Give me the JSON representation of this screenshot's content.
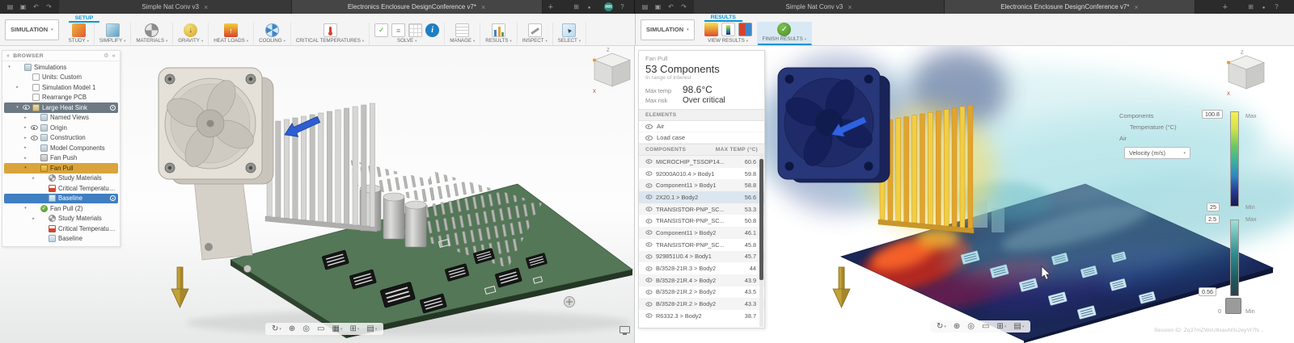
{
  "viewcube": {
    "z": "Z",
    "x": "X"
  },
  "setup_window": {
    "tb_icons_left": [
      "tbi-menu",
      "tbi-save",
      "tbi-undo",
      "tbi-redo"
    ],
    "tb_icons_right": [
      "tbi-ext",
      "tbi-bell"
    ],
    "avatar": "HH",
    "help_icon": "tbi-help",
    "tabs": [
      {
        "label": "Simple Nat Conv v3",
        "cls": ""
      },
      {
        "label": "Electronics Enclosure DesignConference v7*",
        "cls": "active"
      }
    ],
    "workspace": "SIMULATION",
    "ribbon_tab": "SETUP",
    "groups": [
      {
        "label": "STUDY",
        "icons": [
          "ic-study"
        ],
        "cls": ""
      },
      {
        "label": "SIMPLIFY",
        "icons": [
          "ic-simplify"
        ],
        "cls": ""
      },
      {
        "label": "MATERIALS",
        "icons": [
          "ic-materials"
        ],
        "cls": ""
      },
      {
        "label": "GRAVITY",
        "icons": [
          "ic-gravity"
        ],
        "cls": ""
      },
      {
        "label": "HEAT LOADS",
        "icons": [
          "ic-heat"
        ],
        "cls": ""
      },
      {
        "label": "COOLING",
        "icons": [
          "ic-cooling"
        ],
        "cls": ""
      },
      {
        "label": "CRITICAL TEMPERATURES",
        "icons": [
          "ic-critical"
        ],
        "cls": ""
      },
      {
        "label": "SOLVE",
        "icons": [
          "ic-precheck",
          "ic-compare",
          "ic-table",
          "ic-info"
        ],
        "cls": ""
      },
      {
        "label": "MANAGE",
        "icons": [
          "ic-manage"
        ],
        "cls": ""
      },
      {
        "label": "RESULTS",
        "icons": [
          "ic-results"
        ],
        "cls": ""
      },
      {
        "label": "INSPECT",
        "icons": [
          "ic-inspect"
        ],
        "cls": ""
      },
      {
        "label": "SELECT",
        "icons": [
          "ic-select"
        ],
        "cls": ""
      }
    ],
    "browser": {
      "title": "BROWSER",
      "tree": [
        {
          "arrow": "▾",
          "eye": "none",
          "icon": "tic-folder",
          "label": "Simulations",
          "cls": "ind0",
          "trail": ""
        },
        {
          "arrow": "",
          "eye": "none",
          "icon": "tic-doc",
          "label": "Units: Custom",
          "cls": "ind1",
          "trail": ""
        },
        {
          "arrow": "▸",
          "eye": "none",
          "icon": "tic-doc",
          "label": "Simulation Model 1",
          "cls": "ind1",
          "trail": ""
        },
        {
          "arrow": "",
          "eye": "none",
          "icon": "tic-doc",
          "label": "Rearrange PCB",
          "cls": "ind1",
          "trail": ""
        },
        {
          "arrow": "▾",
          "eye": "show",
          "icon": "tic-model",
          "label": "Large Heat Sink",
          "cls": "ind1 sel-dark",
          "trail": "t-radio"
        },
        {
          "arrow": "▸",
          "eye": "none",
          "icon": "tic-folder",
          "label": "Named Views",
          "cls": "ind2",
          "trail": ""
        },
        {
          "arrow": "▸",
          "eye": "show",
          "icon": "tic-folder",
          "label": "Origin",
          "cls": "ind2",
          "trail": ""
        },
        {
          "arrow": "▸",
          "eye": "show",
          "icon": "tic-folder",
          "label": "Construction",
          "cls": "ind2",
          "trail": ""
        },
        {
          "arrow": "▸",
          "eye": "none",
          "icon": "tic-folder",
          "label": "Model Components",
          "cls": "ind2",
          "trail": ""
        },
        {
          "arrow": "▸",
          "eye": "none",
          "icon": "tic-study",
          "label": "Fan Push",
          "cls": "ind2",
          "trail": ""
        },
        {
          "arrow": "▾",
          "eye": "none",
          "icon": "tic-study-a",
          "label": "Fan Pull",
          "cls": "ind2 sel-orange",
          "trail": ""
        },
        {
          "arrow": "▸",
          "eye": "none",
          "icon": "tic-mat",
          "label": "Study Materials",
          "cls": "ind3",
          "trail": ""
        },
        {
          "arrow": "",
          "eye": "none",
          "icon": "tic-crit",
          "label": "Critical Temperatures",
          "cls": "ind3",
          "trail": ""
        },
        {
          "arrow": "",
          "eye": "none",
          "icon": "tic-base",
          "label": "Baseline",
          "cls": "ind3 sel-blue",
          "trail": "t-radio"
        },
        {
          "arrow": "▾",
          "eye": "none",
          "icon": "tic-check",
          "label": "Fan Pull (2)",
          "cls": "ind2",
          "trail": ""
        },
        {
          "arrow": "▸",
          "eye": "none",
          "icon": "tic-mat",
          "label": "Study Materials",
          "cls": "ind3",
          "trail": ""
        },
        {
          "arrow": "",
          "eye": "none",
          "icon": "tic-crit",
          "label": "Critical Temperatures",
          "cls": "ind3",
          "trail": ""
        },
        {
          "arrow": "",
          "eye": "none",
          "icon": "tic-base",
          "label": "Baseline",
          "cls": "ind3",
          "trail": ""
        }
      ]
    },
    "navbar": [
      "nv-orbit c",
      "nv-pan",
      "nv-zoom",
      "nv-fit",
      "nv-display c",
      "nv-grid c",
      "nv-set c"
    ]
  },
  "results_window": {
    "tb_icons_left": [
      "tbi-menu",
      "tbi-save",
      "tbi-undo",
      "tbi-redo"
    ],
    "tb_icons_right": [
      "tbi-ext",
      "tbi-bell",
      "tbi-help"
    ],
    "tabs": [
      {
        "label": "Simple Nat Conv v3",
        "cls": ""
      },
      {
        "label": "Electronics Enclosure DesignConference v7*",
        "cls": "active"
      }
    ],
    "workspace": "SIMULATION",
    "ribbon_tab": "RESULTS",
    "groups": [
      {
        "label": "VIEW RESULTS",
        "icons": [
          "ic-vr1",
          "ic-vr2",
          "ic-vr3"
        ],
        "cls": ""
      },
      {
        "label": "FINISH RESULTS",
        "icons": [
          "ic-finish"
        ],
        "cls": "hl"
      }
    ],
    "panel": {
      "study": "Fan Pull",
      "count": "53 Components",
      "range": "In range of interest",
      "max_temp_label": "Max temp",
      "max_temp": "98.6°C",
      "max_risk_label": "Max risk",
      "max_risk": "Over critical",
      "elements_header": "ELEMENTS",
      "elements": [
        {
          "label": "Air"
        },
        {
          "label": "Load case"
        }
      ],
      "components_header": "COMPONENTS",
      "temp_col": "MAX TEMP (°C)",
      "components": [
        {
          "name": "MICROCHIP_TSSOP14...",
          "temp": "60.6",
          "cls": ""
        },
        {
          "name": "92000A010.4 > Body1",
          "temp": "59.8",
          "cls": ""
        },
        {
          "name": "Component11 > Body1",
          "temp": "58.8",
          "cls": ""
        },
        {
          "name": "2X20.1 > Body2",
          "temp": "56.6",
          "cls": "selrow"
        },
        {
          "name": "TRANSISTOR-PNP_SC...",
          "temp": "53.3",
          "cls": ""
        },
        {
          "name": "TRANSISTOR-PNP_SC...",
          "temp": "50.8",
          "cls": ""
        },
        {
          "name": "Component11 > Body2",
          "temp": "46.1",
          "cls": ""
        },
        {
          "name": "TRANSISTOR-PNP_SC...",
          "temp": "45.8",
          "cls": ""
        },
        {
          "name": "929851U0.4 > Body1",
          "temp": "45.7",
          "cls": ""
        },
        {
          "name": "B/3528-21R.3 > Body2",
          "temp": "44",
          "cls": ""
        },
        {
          "name": "B/3528-21R.4 > Body2",
          "temp": "43.9",
          "cls": ""
        },
        {
          "name": "B/3528-21R.2 > Body2",
          "temp": "43.5",
          "cls": ""
        },
        {
          "name": "B/3528-21R.2 > Body2",
          "temp": "43.3",
          "cls": ""
        },
        {
          "name": "R6332.3 > Body2",
          "temp": "38.7",
          "cls": ""
        }
      ]
    },
    "legend": {
      "components_label": "Components",
      "temperature_label": "Temperature (°C)",
      "air_label": "Air",
      "velocity_label": "Velocity (m/s)",
      "temp_max": "100.8",
      "temp_max_tag": "Max",
      "temp_min": "25",
      "temp_min_tag": "Min",
      "vel_max": "2.5",
      "vel_max_tag": "Max",
      "vel_current": "0.56",
      "vel_min": "0",
      "vel_min_tag": "Min"
    },
    "navbar": [
      "nv-orbit c",
      "nv-pan",
      "nv-zoom",
      "nv-fit",
      "nv-grid c",
      "nv-set c"
    ],
    "session": "Session ID: Zq37mZWxU8xauN0s2eyVr7N..."
  }
}
